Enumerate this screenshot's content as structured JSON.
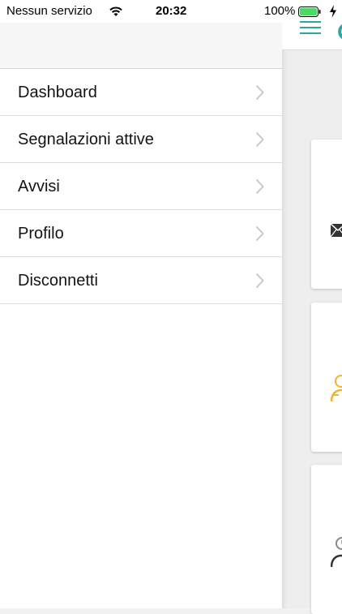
{
  "statusbar": {
    "carrier": "Nessun servizio",
    "time": "20:32",
    "battery": "100%"
  },
  "menu": {
    "items": [
      {
        "label": "Dashboard"
      },
      {
        "label": "Segnalazioni attive"
      },
      {
        "label": "Avvisi"
      },
      {
        "label": "Profilo"
      },
      {
        "label": "Disconnetti"
      }
    ]
  },
  "colors": {
    "accent": "#2aa8a0",
    "warning": "#f2b430",
    "battery": "#4cd964"
  },
  "icons": {
    "menu": "hamburger-icon",
    "row": "chevron-right-icon",
    "card1": "mail-icon",
    "card2": "user-warning-icon",
    "card3": "user-clock-icon"
  }
}
